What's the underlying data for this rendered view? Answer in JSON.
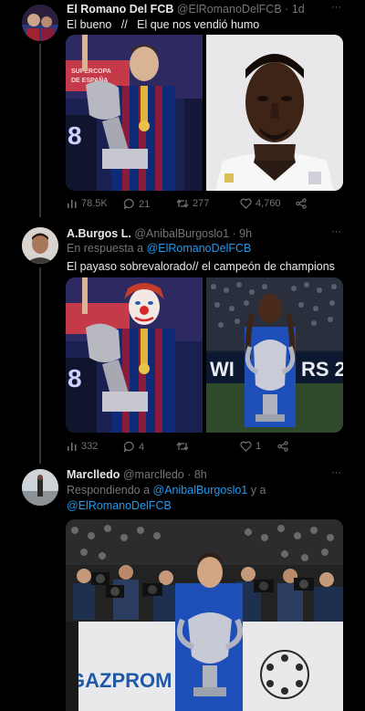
{
  "tweets": [
    {
      "name": "El Romano Del FCB",
      "handle": "@ElRomanoDelFCB",
      "time": "· 1d",
      "text": "El bueno   //   El que nos vendió humo",
      "stats": {
        "views": "78.5K",
        "replies": "21",
        "retweets": "277",
        "likes": "4,760"
      },
      "media_text": {
        "trophy_banner": "SUPERCOPA DE ESPAÑA"
      }
    },
    {
      "name": "A.Burgos L.",
      "handle": "@AnibalBurgoslo1",
      "time": "· 9h",
      "reply_prefix": "En respuesta a ",
      "reply_to": "@ElRomanoDelFCB",
      "text": "El payaso sobrevalorado// el campeón de champions",
      "stats": {
        "views": "332",
        "replies": "4",
        "retweets": "",
        "likes": "1"
      },
      "media_text": {
        "banner": "WINNERS 2"
      }
    },
    {
      "name": "Marclledo",
      "handle": "@marclledo",
      "time": "· 8h",
      "reply_prefix": "Respondiendo a ",
      "reply_to_1": "@AnibalBurgoslo1",
      "reply_joiner": " y a",
      "reply_to_2": "@ElRomanoDelFCB",
      "media_text": {
        "sponsor": "GAZPROM"
      }
    }
  ],
  "colors": {
    "background": "#000000",
    "text": "#e7e9ea",
    "secondary": "#71767b",
    "link": "#1d9bf0",
    "divider": "#2f3336"
  }
}
